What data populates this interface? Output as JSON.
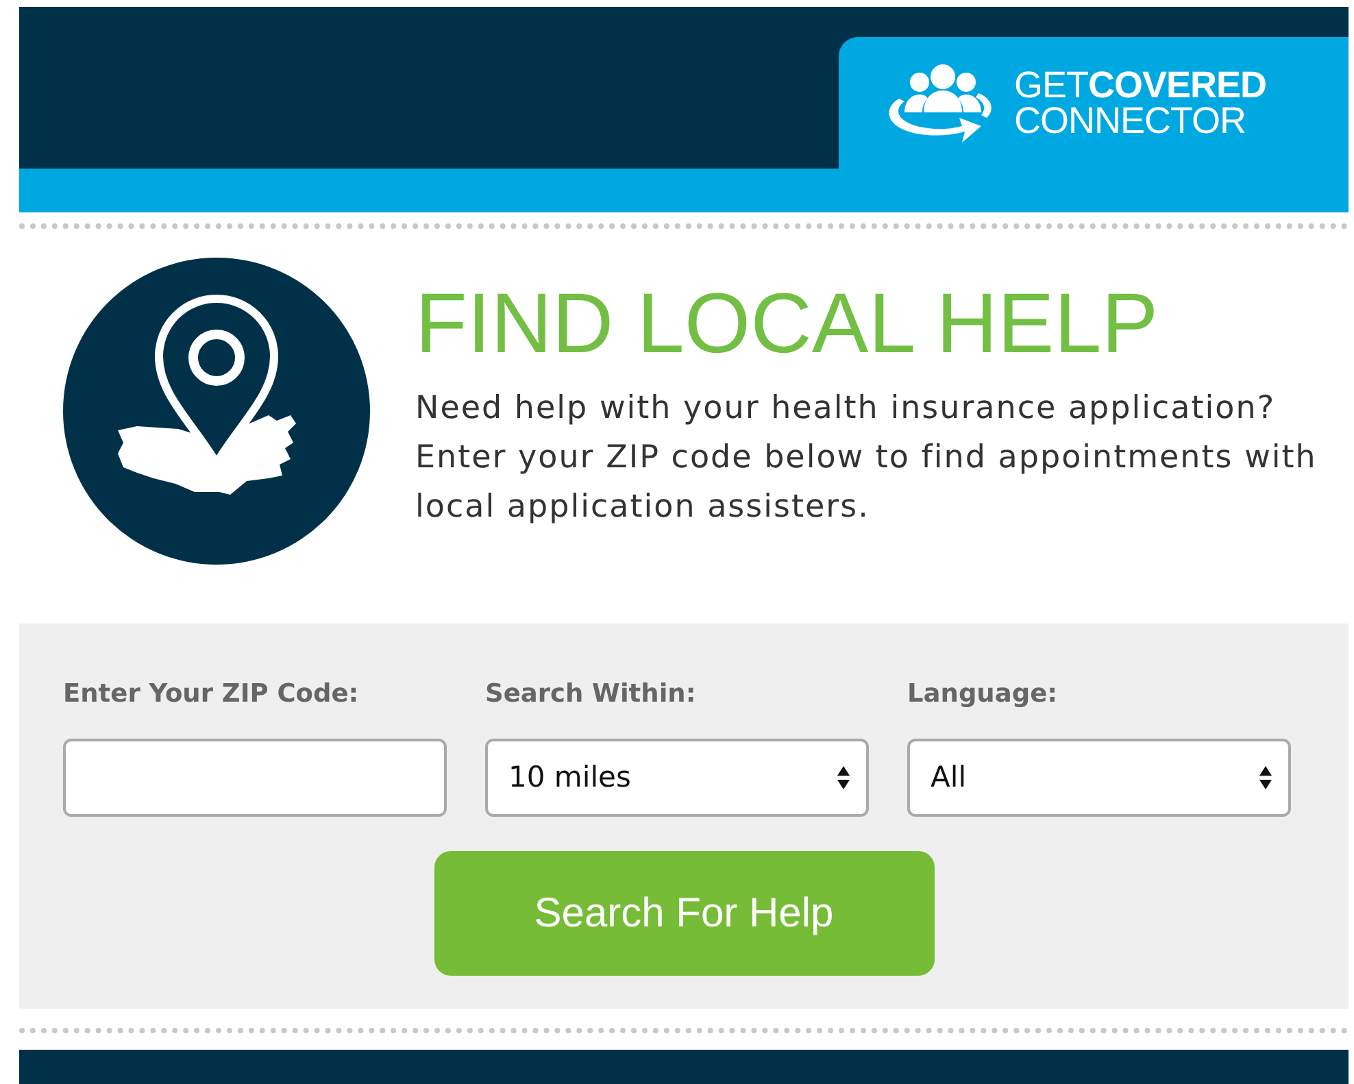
{
  "logo": {
    "line_1": "GET**COVERED**",
    "line_2": "CONNECTOR"
  },
  "intro": {
    "title": "FIND LOCAL HELP",
    "text": "Need help with your health insurance application? Enter your ZIP code below to find appointments with local application assisters."
  },
  "form": {
    "fields": [
      {
        "kind": "input",
        "label": "Enter Your ZIP Code:"
      },
      {
        "kind": "select",
        "label": "Search Within:",
        "value": "10 miles"
      },
      {
        "kind": "select",
        "label": "Language:",
        "value": "All"
      }
    ],
    "button": "Search For Help"
  }
}
